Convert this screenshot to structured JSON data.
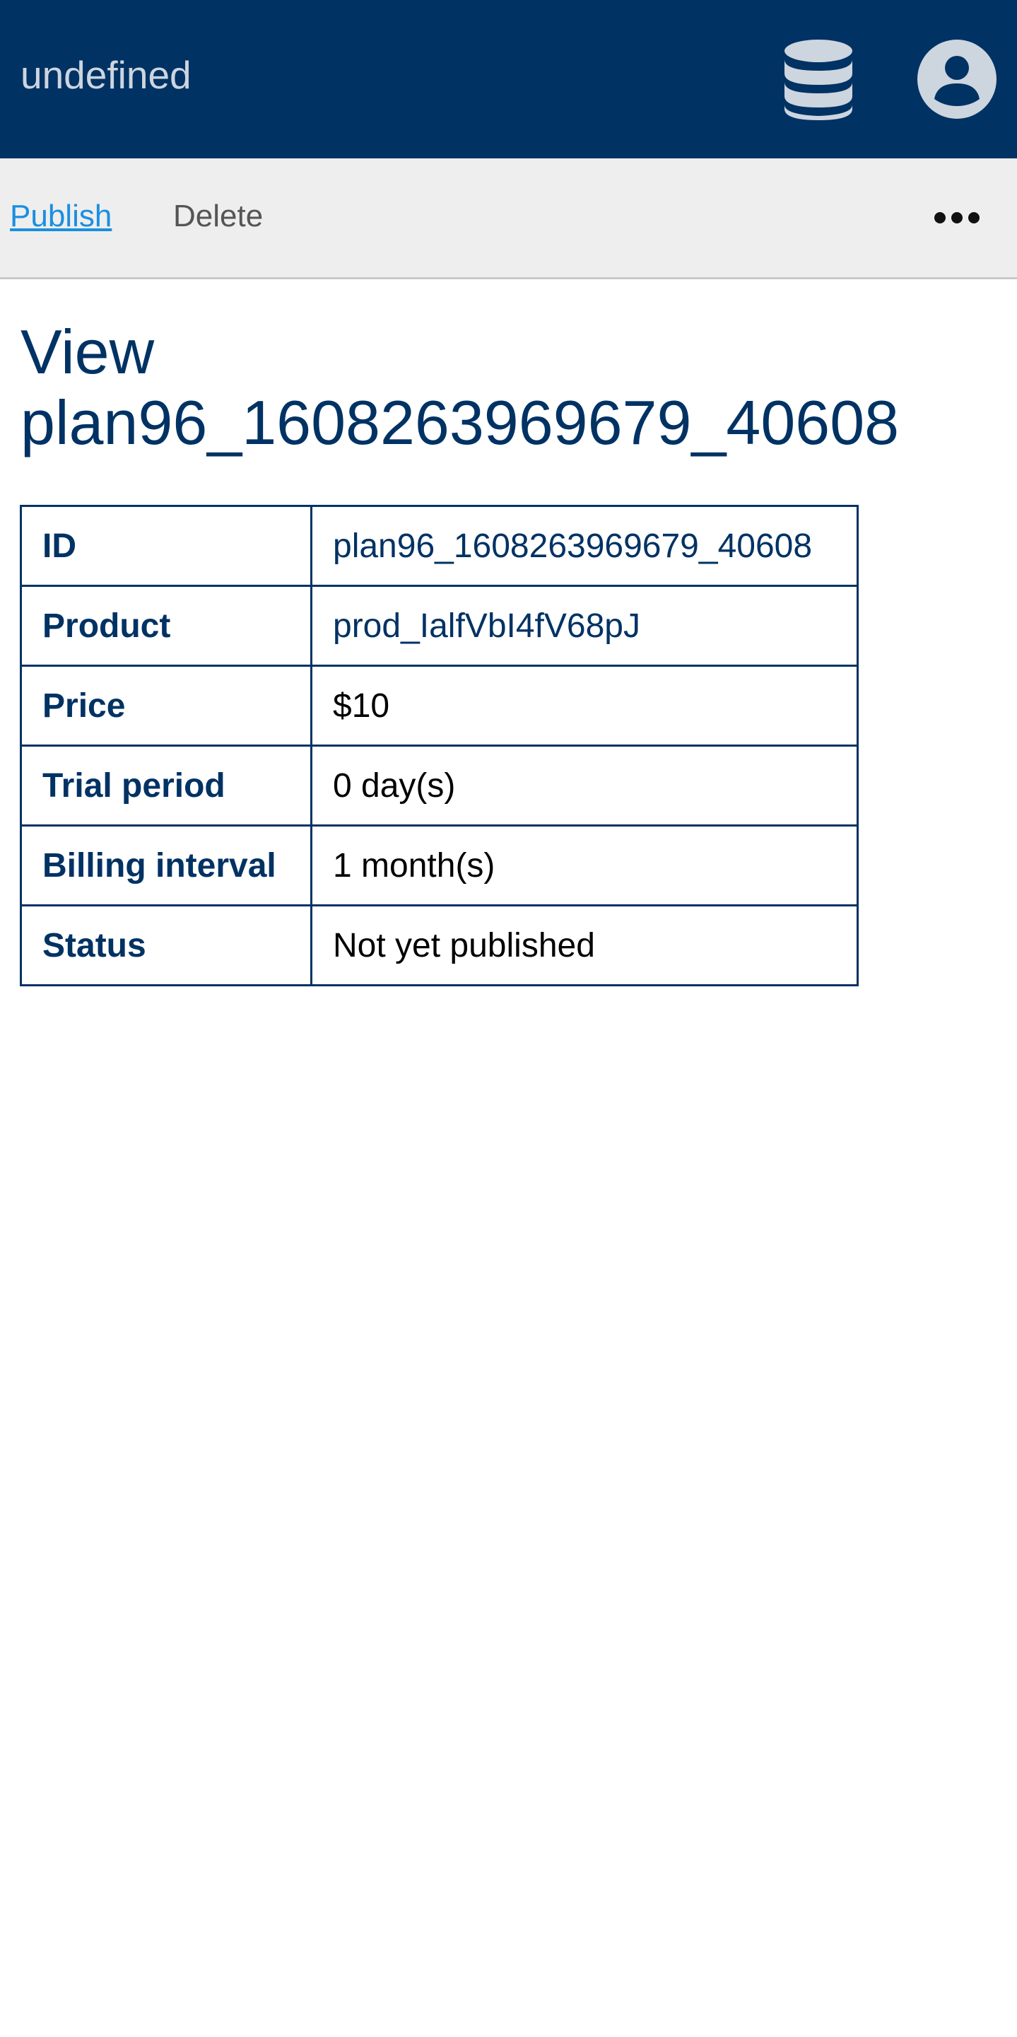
{
  "header": {
    "app_title": "undefined",
    "icons": [
      "database-icon",
      "account-icon"
    ],
    "background_color": "#003264"
  },
  "toolbar": {
    "publish_label": "Publish",
    "delete_label": "Delete",
    "more_icon": "more-horizontal-icon"
  },
  "page": {
    "title_prefix": "View",
    "title_id": "plan96_1608263969679_40608"
  },
  "details": {
    "rows": [
      {
        "label": "ID",
        "value": "plan96_1608263969679_40608"
      },
      {
        "label": "Product",
        "value": "prod_IalfVbI4fV68pJ"
      },
      {
        "label": "Price",
        "value": "$10"
      },
      {
        "label": "Trial period",
        "value": "0 day(s)"
      },
      {
        "label": "Billing interval",
        "value": "1 month(s)"
      },
      {
        "label": "Status",
        "value": "Not yet published"
      }
    ]
  },
  "colors": {
    "primary": "#003264",
    "link": "#1a8fe0",
    "toolbar_bg": "#eeeeee"
  }
}
